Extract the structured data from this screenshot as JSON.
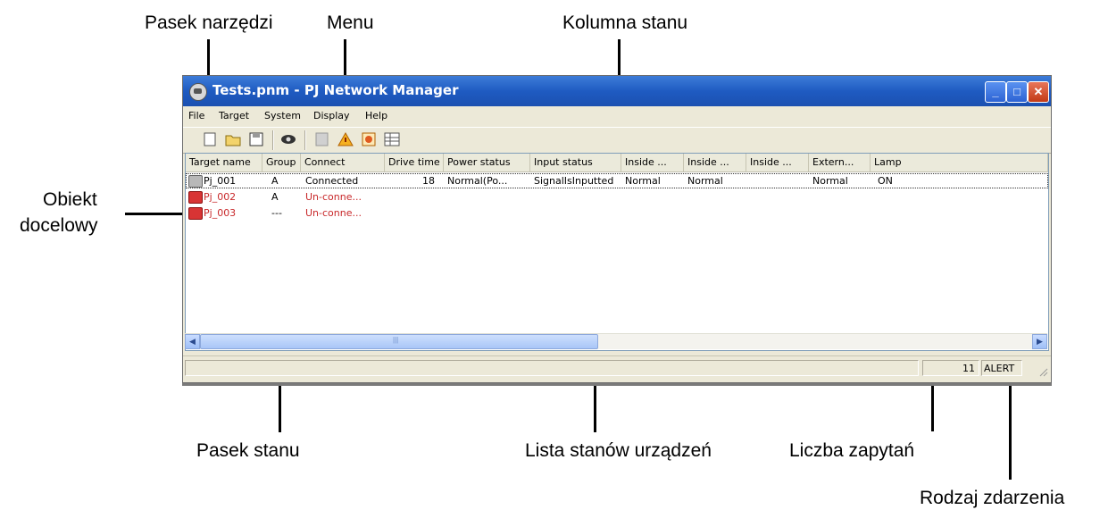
{
  "callouts": {
    "toolbar": "Pasek narzędzi",
    "menu": "Menu",
    "status_column": "Kolumna stanu",
    "target_object_line1": "Obiekt",
    "target_object_line2": "docelowy",
    "status_bar": "Pasek stanu",
    "device_status_list": "Lista stanów urządzeń",
    "query_count": "Liczba zapytań",
    "event_type": "Rodzaj zdarzenia"
  },
  "window": {
    "title": "Tests.pnm - PJ Network Manager",
    "minimize_glyph": "_",
    "maximize_glyph": "□",
    "close_glyph": "✕"
  },
  "menu": {
    "items": [
      "File",
      "Target",
      "System",
      "Display",
      "Help"
    ]
  },
  "toolbar": {
    "icons": [
      "new-icon",
      "open-icon",
      "save-icon",
      "view-icon",
      "blank-icon",
      "warning-icon",
      "alert-icon",
      "grid-icon"
    ]
  },
  "table": {
    "columns": [
      "Target name",
      "Group",
      "Connect",
      "Drive time",
      "Power status",
      "Input status",
      "Inside ...",
      "Inside ...",
      "Inside ...",
      "Extern...",
      "Lamp"
    ],
    "rows": [
      {
        "name": "Pj_001",
        "group": "A",
        "connect": "Connected",
        "drive_time": "18",
        "power": "Normal(Po...",
        "input": "SignalIsInputted",
        "inside1": "Normal",
        "inside2": "Normal",
        "inside3": "",
        "extern": "Normal",
        "lamp": "ON",
        "error": false
      },
      {
        "name": "Pj_002",
        "group": "A",
        "connect": "Un-conne...",
        "drive_time": "",
        "power": "",
        "input": "",
        "inside1": "",
        "inside2": "",
        "inside3": "",
        "extern": "",
        "lamp": "",
        "error": true
      },
      {
        "name": "Pj_003",
        "group": "---",
        "connect": "Un-conne...",
        "drive_time": "",
        "power": "",
        "input": "",
        "inside1": "",
        "inside2": "",
        "inside3": "",
        "extern": "",
        "lamp": "",
        "error": true
      }
    ]
  },
  "scrollbar": {
    "left_arrow": "◀",
    "right_arrow": "▶",
    "thumb_grip": "|||"
  },
  "statusbar": {
    "query_count": "11",
    "event_type": "ALERT"
  }
}
